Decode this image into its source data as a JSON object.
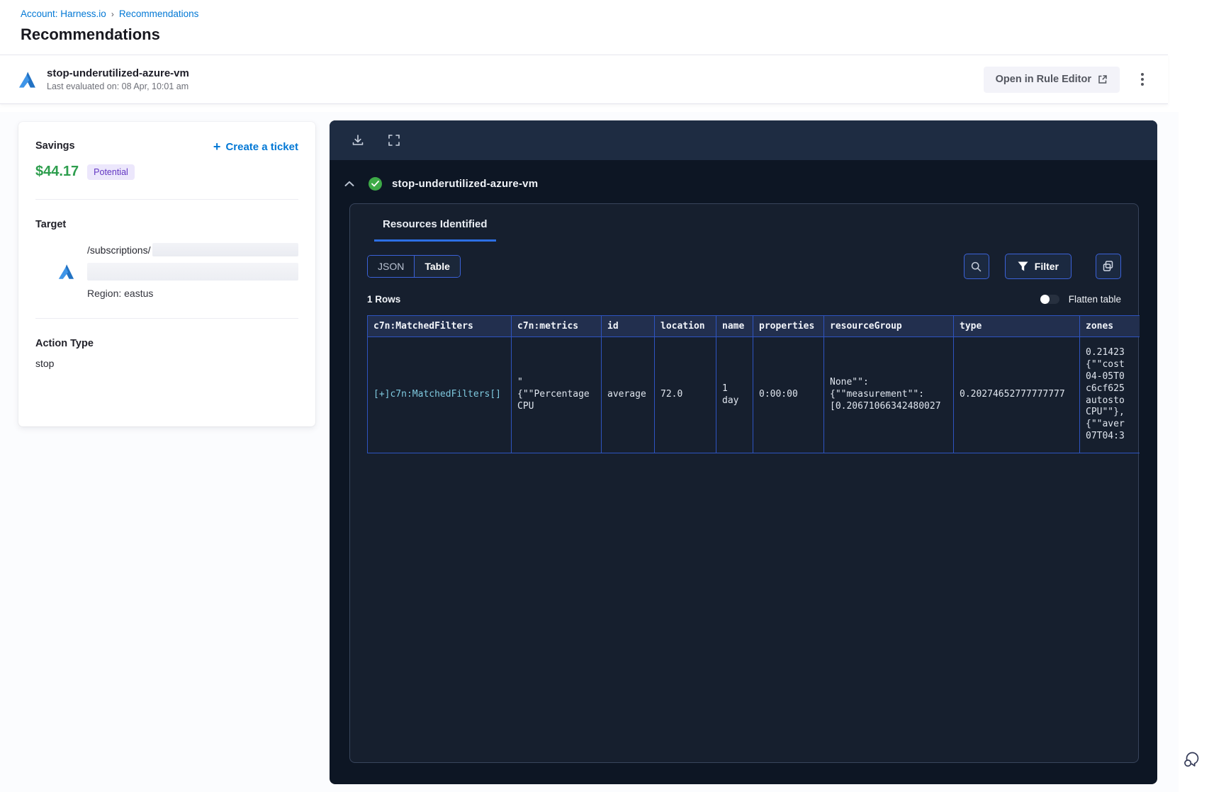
{
  "breadcrumb": {
    "account": "Account: Harness.io",
    "separator": "›",
    "current": "Recommendations"
  },
  "page_title": "Recommendations",
  "rule_header": {
    "name": "stop-underutilized-azure-vm",
    "last_evaluated": "Last evaluated on: 08 Apr, 10:01 am",
    "open_in_rule_editor": "Open in Rule Editor"
  },
  "savings_card": {
    "savings_label": "Savings",
    "amount": "$44.17",
    "badge": "Potential",
    "plus": "+",
    "create_ticket_label": "Create a ticket",
    "target_label": "Target",
    "target_path_prefix": "/subscriptions/",
    "region": "Region: eastus",
    "action_type_label": "Action Type",
    "action_type_value": "stop"
  },
  "panel": {
    "title": "stop-underutilized-azure-vm",
    "tab_label": "Resources Identified",
    "toggle_json": "JSON",
    "toggle_table": "Table",
    "filter_label": "Filter",
    "rows_count": "1 Rows",
    "flatten_label": "Flatten table"
  },
  "table": {
    "columns": [
      "c7n:MatchedFilters",
      "c7n:metrics",
      "id",
      "location",
      "name",
      "properties",
      "resourceGroup",
      "type",
      "zones"
    ],
    "row": [
      "[+]c7n:MatchedFilters[]",
      "\"\n{\"\"Percentage\nCPU",
      "average",
      "72.0",
      "1\nday",
      "0:00:00",
      "None\"\":\n{\"\"measurement\"\":\n[0.20671066342480027",
      "0.20274652777777777",
      "0.21423\n{\"\"cost\n04-05T0\nc6cf625\nautosto\nCPU\"\"},\n{\"\"aver\n07T04:3"
    ]
  },
  "icons": {
    "azure": "azure-logo",
    "download": "download-icon",
    "fullscreen": "fullscreen-icon",
    "collapse": "chevron-up-icon",
    "success": "check-circle-icon",
    "search": "search-icon",
    "filter": "filter-funnel-icon",
    "copy": "copy-icon",
    "external": "external-link-icon",
    "kebab": "kebab-menu-icon",
    "chat": "chat-bubbles-icon"
  },
  "colors": {
    "link_blue": "#0278d5",
    "savings_green": "#2e9e4e",
    "badge_bg": "#ece7fc",
    "badge_text": "#6236c2",
    "panel_bg": "#0d1624",
    "panel_toolbar_bg": "#1e2c42",
    "inner_panel_bg": "#161f2e",
    "table_border": "#2e54c1",
    "table_header_bg": "#222f4e",
    "accent_border": "#3b62d9",
    "tab_underline": "#2d6fe4",
    "cell_link": "#7fc9df",
    "check_green": "#3daa47"
  }
}
